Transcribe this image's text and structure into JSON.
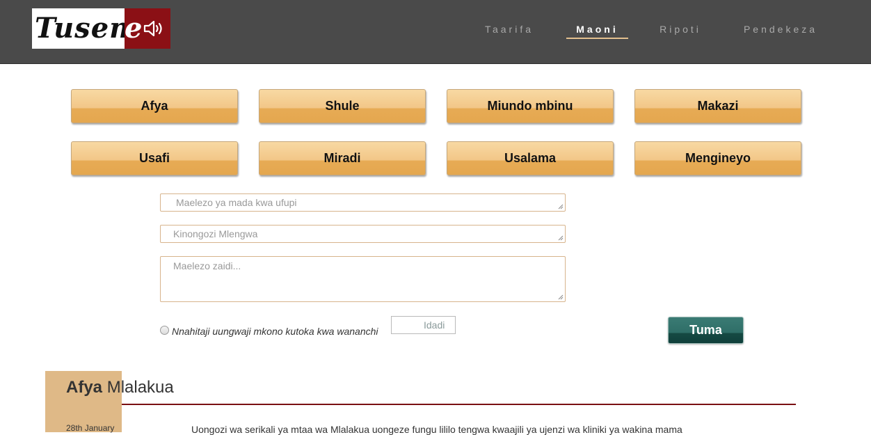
{
  "header": {
    "logo_text": "Tusem",
    "logo_e": "e",
    "nav": [
      {
        "label": "Taarifa",
        "active": false
      },
      {
        "label": "Maoni",
        "active": true
      },
      {
        "label": "Ripoti",
        "active": false
      },
      {
        "label": "Pendekeza",
        "active": false
      }
    ]
  },
  "categories": [
    "Afya",
    "Shule",
    "Miundo mbinu",
    "Makazi",
    "Usafi",
    "Miradi",
    "Usalama",
    "Mengineyo"
  ],
  "form": {
    "title_placeholder": "Maelezo ya mada kwa ufupi",
    "leader_placeholder": "Kinongozi Mlengwa",
    "details_placeholder": "Maelezo zaidi...",
    "support_label": "Nnahitaji uungwaji mkono kutoka kwa wananchi",
    "count_placeholder": "Idadi",
    "submit_label": "Tuma"
  },
  "post": {
    "category": "Afya",
    "location": "Mlalakua",
    "date": "28th January",
    "body": "Uongozi wa serikali ya mtaa wa Mlalakua uongeze fungu lililo tengwa kwaajili ya ujenzi wa kliniki ya wakina mama"
  },
  "colors": {
    "header_bg": "#4a4a4a",
    "logo_red": "#8b1015",
    "button_orange": "#f2c687",
    "submit_teal": "#2f6e67",
    "rule_red": "#7a0f12",
    "tab_tan": "#dfb987"
  }
}
